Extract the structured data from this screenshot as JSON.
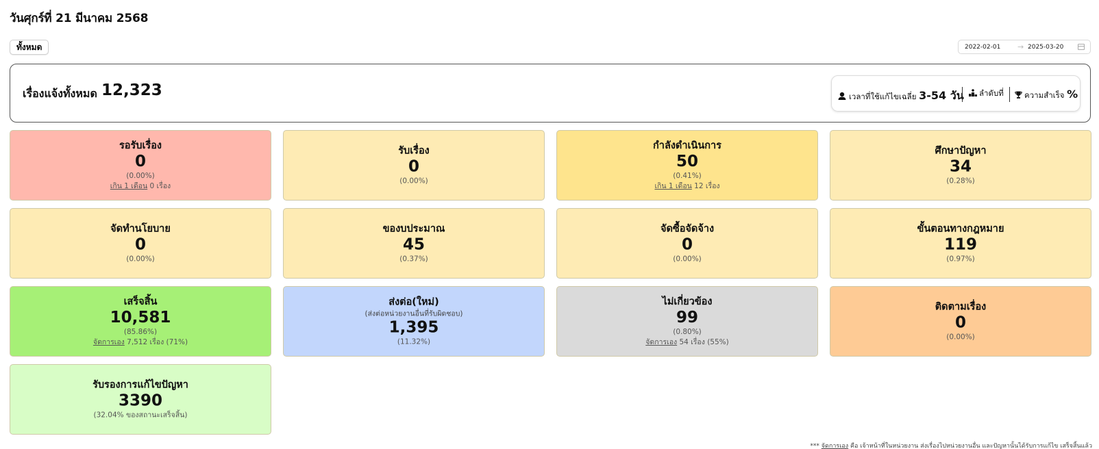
{
  "page": {
    "date_title": "วันศุกร์ที่ 21 มีนาคม 2568"
  },
  "filter": {
    "all_label": "ทั้งหมด"
  },
  "date_range": {
    "start": "2022-02-01",
    "arrow": "→",
    "end": "2025-03-20",
    "icon": "calendar-icon"
  },
  "summary": {
    "label": "เรื่องแจ้งทั้งหมด",
    "total": "12,323",
    "avg_time_label": "เวลาที่ใช้แก้ไขเฉลี่ย",
    "avg_time_value": "3-54 วัน",
    "rank_label": "ลำดับที่",
    "success_label": "ความสำเร็จ",
    "success_value": "%"
  },
  "cards": [
    {
      "title": "รอรับเรื่อง",
      "count": "0",
      "percent": "(0.00%)",
      "extra_link": "เกิน 1 เดือน",
      "extra_text": " 0 เรื่อง",
      "color": "#ffb8ad"
    },
    {
      "title": "รับเรื่อง",
      "count": "0",
      "percent": "(0.00%)",
      "color": "#feebb4"
    },
    {
      "title": "กำลังดำเนินการ",
      "count": "50",
      "percent": "(0.41%)",
      "extra_link": "เกิน 1 เดือน",
      "extra_text": " 12 เรื่อง",
      "color": "#fee48d"
    },
    {
      "title": "ศึกษาปัญหา",
      "count": "34",
      "percent": "(0.28%)",
      "color": "#feebb4"
    },
    {
      "title": "จัดทำนโยบาย",
      "count": "0",
      "percent": "(0.00%)",
      "color": "#feebb4"
    },
    {
      "title": "ของบประมาณ",
      "count": "45",
      "percent": "(0.37%)",
      "color": "#feebb4"
    },
    {
      "title": "จัดซื้อจัดจ้าง",
      "count": "0",
      "percent": "(0.00%)",
      "color": "#feebb4"
    },
    {
      "title": "ขั้นตอนทางกฎหมาย",
      "count": "119",
      "percent": "(0.97%)",
      "color": "#feebb4"
    },
    {
      "title": "เสร็จสิ้น",
      "count": "10,581",
      "percent": "(85.86%)",
      "extra_link": "จัดการเอง",
      "extra_text": " 7,512 เรื่อง (71%)",
      "color": "#a6f076"
    },
    {
      "title": "ส่งต่อ(ใหม่)",
      "subtitle": "(ส่งต่อหน่วยงานอื่นที่รับผิดชอบ)",
      "count": "1,395",
      "percent": "(11.32%)",
      "color": "#c2d6fc"
    },
    {
      "title": "ไม่เกี่ยวข้อง",
      "count": "99",
      "percent": "(0.80%)",
      "extra_link": "จัดการเอง",
      "extra_text": " 54 เรื่อง (55%)",
      "color": "#dadada"
    },
    {
      "title": "ติดตามเรื่อง",
      "count": "0",
      "percent": "(0.00%)",
      "color": "#fecb95"
    },
    {
      "title": "รับรองการแก้ไขปัญหา",
      "count": "3390",
      "percent": "(32.04% ของสถานะเสร็จสิ้น)",
      "color": "#d8fdc6"
    }
  ],
  "footnote": {
    "prefix": "*** ",
    "link": "จัดการเอง",
    "text": " คือ เจ้าหน้าที่ในหน่วยงาน ส่งเรื่องไปหน่วยงานอื่น และปัญหานั้นได้รับการแก้ไข เสร็จสิ้นแล้ว"
  }
}
